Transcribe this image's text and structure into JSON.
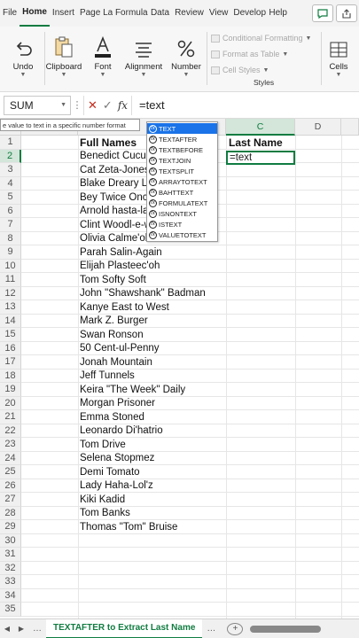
{
  "ribbon_tabs": [
    "File",
    "Home",
    "Insert",
    "Page Layout",
    "Formulas",
    "Data",
    "Review",
    "View",
    "Developer",
    "Help"
  ],
  "active_tab": "Home",
  "groups": {
    "undo": "Undo",
    "clipboard": "Clipboard",
    "font": "Font",
    "alignment": "Alignment",
    "number": "Number",
    "cells": "Cells"
  },
  "styles": {
    "conditional": "Conditional Formatting",
    "format_table": "Format as Table",
    "cell_styles": "Cell Styles",
    "caption": "Styles"
  },
  "formula_bar": {
    "name_box": "SUM",
    "formula": "=text"
  },
  "tooltip": "e value to text in a specific number format",
  "autocomplete": [
    "TEXT",
    "TEXTAFTER",
    "TEXTBEFORE",
    "TEXTJOIN",
    "TEXTSPLIT",
    "ARRAYTOTEXT",
    "BAHTTEXT",
    "FORMULATEXT",
    "ISNONTEXT",
    "ISTEXT",
    "VALUETOTEXT"
  ],
  "columns": [
    "C",
    "D"
  ],
  "rows": [
    "1",
    "2",
    "3",
    "4",
    "5",
    "6",
    "7",
    "8",
    "9",
    "10",
    "11",
    "12",
    "13",
    "14",
    "15",
    "16",
    "17",
    "18",
    "19",
    "20",
    "21",
    "22",
    "23",
    "24",
    "25",
    "26",
    "27",
    "28",
    "29",
    "30",
    "31",
    "32",
    "33",
    "34",
    "35"
  ],
  "cells": {
    "full_names_header": "Full Names",
    "last_name_header": "Last Name",
    "active_value": "=text",
    "names": [
      "Benedict Cucumber",
      "Cat Zeta-Jones",
      "Blake Dreary Lively",
      "Bey Twice Once",
      "Arnold hasta-la-vista",
      "Clint Woodl-e-wood",
      "Olivia Calme'ol",
      "Parah Salin-Again",
      "Elijah Plasteec'oh",
      "Tom Softy Soft",
      "John \"Shawshank\" Badman",
      "Kanye East to West",
      "Mark Z. Burger",
      "Swan Ronson",
      "50 Cent-ul-Penny",
      "Jonah Mountain",
      "Jeff Tunnels",
      "Keira \"The Week\" Daily",
      "Morgan Prisoner",
      "Emma Stoned",
      "Leonardo Di'hatrio",
      "Tom Drive",
      "Selena Stopmez",
      "Demi Tomato",
      "Lady Haha-Lol'z",
      "Kiki Kadid",
      "Tom Banks",
      "Thomas \"Tom\" Bruise"
    ]
  },
  "sheet_tab": "TEXTAFTER to Extract Last Name"
}
